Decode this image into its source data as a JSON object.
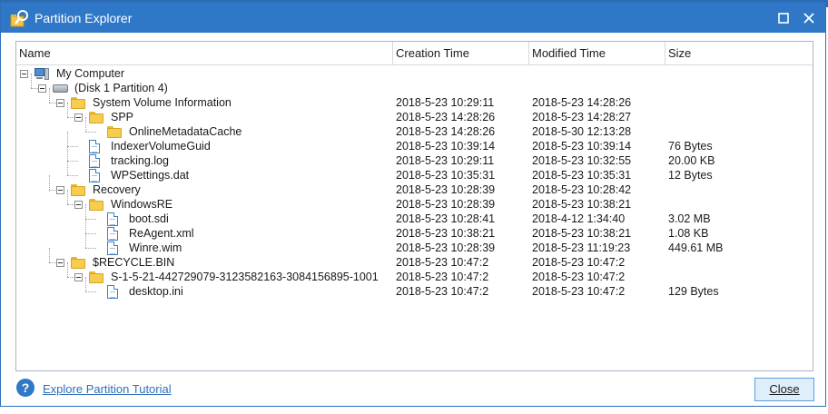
{
  "window": {
    "title": "Partition Explorer",
    "maximize_glyph": "□",
    "close_glyph": "✕"
  },
  "columns": {
    "name": "Name",
    "creation_time": "Creation Time",
    "modified_time": "Modified Time",
    "size": "Size"
  },
  "tree": [
    {
      "level": 0,
      "icon": "computer-icon",
      "expander": true,
      "name": "My Computer",
      "ctime": "",
      "mtime": "",
      "size": ""
    },
    {
      "level": 1,
      "icon": "disk-icon",
      "expander": true,
      "name": "(Disk 1 Partition 4)",
      "ctime": "",
      "mtime": "",
      "size": ""
    },
    {
      "level": 2,
      "icon": "folder-icon",
      "expander": true,
      "name": "System Volume Information",
      "ctime": "2018-5-23 10:29:11",
      "mtime": "2018-5-23 14:28:26",
      "size": ""
    },
    {
      "level": 3,
      "icon": "folder-icon",
      "expander": true,
      "name": "SPP",
      "ctime": "2018-5-23 14:28:26",
      "mtime": "2018-5-23 14:28:27",
      "size": ""
    },
    {
      "level": 4,
      "icon": "folder-icon",
      "expander": false,
      "name": "OnlineMetadataCache",
      "ctime": "2018-5-23 14:28:26",
      "mtime": "2018-5-30 12:13:28",
      "size": ""
    },
    {
      "level": 3,
      "icon": "file-icon",
      "expander": false,
      "name": "IndexerVolumeGuid",
      "ctime": "2018-5-23 10:39:14",
      "mtime": "2018-5-23 10:39:14",
      "size": "76 Bytes"
    },
    {
      "level": 3,
      "icon": "file-icon",
      "expander": false,
      "name": "tracking.log",
      "ctime": "2018-5-23 10:29:11",
      "mtime": "2018-5-23 10:32:55",
      "size": "20.00 KB"
    },
    {
      "level": 3,
      "icon": "file-icon",
      "expander": false,
      "name": "WPSettings.dat",
      "ctime": "2018-5-23 10:35:31",
      "mtime": "2018-5-23 10:35:31",
      "size": "12 Bytes"
    },
    {
      "level": 2,
      "icon": "folder-icon",
      "expander": true,
      "name": "Recovery",
      "ctime": "2018-5-23 10:28:39",
      "mtime": "2018-5-23 10:28:42",
      "size": ""
    },
    {
      "level": 3,
      "icon": "folder-icon",
      "expander": true,
      "name": "WindowsRE",
      "ctime": "2018-5-23 10:28:39",
      "mtime": "2018-5-23 10:38:21",
      "size": ""
    },
    {
      "level": 4,
      "icon": "file-icon",
      "expander": false,
      "name": "boot.sdi",
      "ctime": "2018-5-23 10:28:41",
      "mtime": "2018-4-12 1:34:40",
      "size": "3.02 MB"
    },
    {
      "level": 4,
      "icon": "file-icon",
      "expander": false,
      "name": "ReAgent.xml",
      "ctime": "2018-5-23 10:38:21",
      "mtime": "2018-5-23 10:38:21",
      "size": "1.08 KB"
    },
    {
      "level": 4,
      "icon": "file-icon",
      "expander": false,
      "name": "Winre.wim",
      "ctime": "2018-5-23 10:28:39",
      "mtime": "2018-5-23 11:19:23",
      "size": "449.61 MB"
    },
    {
      "level": 2,
      "icon": "folder-icon",
      "expander": true,
      "name": "$RECYCLE.BIN",
      "ctime": "2018-5-23 10:47:2",
      "mtime": "2018-5-23 10:47:2",
      "size": ""
    },
    {
      "level": 3,
      "icon": "folder-icon",
      "expander": true,
      "name": "S-1-5-21-442729079-3123582163-3084156895-1001",
      "ctime": "2018-5-23 10:47:2",
      "mtime": "2018-5-23 10:47:2",
      "size": ""
    },
    {
      "level": 4,
      "icon": "file-icon",
      "expander": false,
      "name": "desktop.ini",
      "ctime": "2018-5-23 10:47:2",
      "mtime": "2018-5-23 10:47:2",
      "size": "129 Bytes"
    }
  ],
  "footer": {
    "help_glyph": "?",
    "tutorial_link": "Explore Partition Tutorial",
    "close_button": "Close"
  },
  "colors": {
    "titlebar": "#2f78c8",
    "link": "#2f6fb8",
    "close_button_bg": "#dfeefb"
  }
}
